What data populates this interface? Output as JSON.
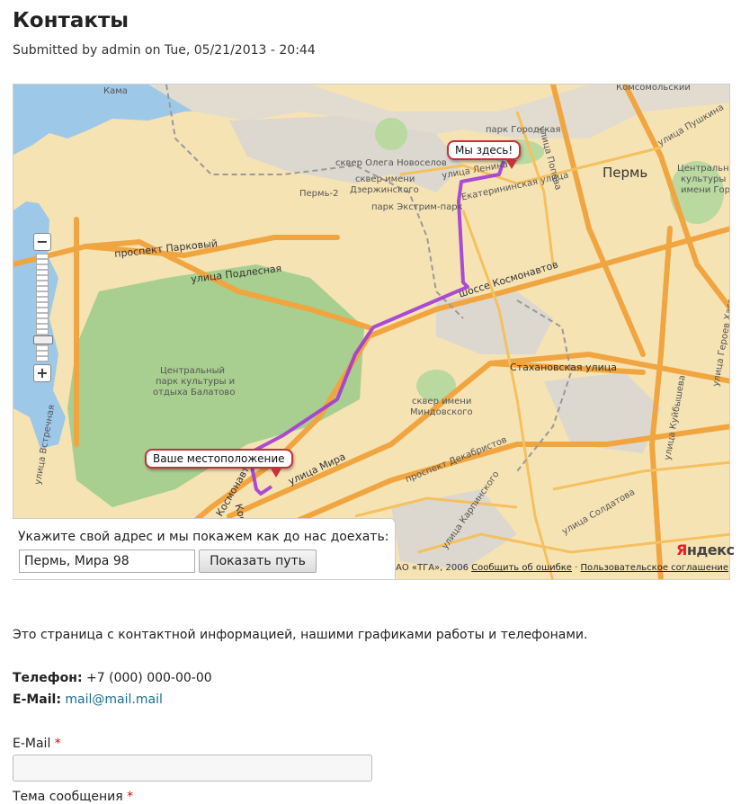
{
  "page": {
    "title": "Контакты",
    "submitted": "Submitted by admin on Tue, 05/21/2013 - 20:44"
  },
  "map": {
    "labels": {
      "kama": "Кама",
      "perm": "Пермь",
      "perm2": "Пермь-2",
      "prospekt_parkovy": "проспект Парковый",
      "podlesnaya": "улица Подлесная",
      "park_name_1": "Центральный",
      "park_name_2": "парк культуры и",
      "park_name_3": "отдыха Балатово",
      "lenina": "улица Ленина",
      "ekaterininskaya": "Екатерининская улица",
      "popova": "улица Попова",
      "pushkina": "улица Пушкина",
      "kosmonavtov": "шоссе Космонавтов",
      "kosmonavtov_2": "шоссе Космонавтов",
      "stakhanovskaya": "Стахановская улица",
      "mira": "улица Мира",
      "dekabristov": "проспект Декабристов",
      "karpinskogo": "улица Карпинского",
      "soldatova": "улица Солдатова",
      "kuybysheva": "улица Куйбышева",
      "geroev_khasana": "улица Героев Хасана",
      "vstrechnaya": "улица Встречная",
      "skver_novoselov_1": "сквер Олега Новоселов",
      "skver_novoselov_2": "сквер имени",
      "skver_novoselov_3": "Дзержинского",
      "park_ekstrim": "парк Экстрим-парк",
      "park_gorodskaya": "парк Городская",
      "skver_mindovskogo_1": "сквер имени",
      "skver_mindovskogo_2": "Миндовского",
      "park_tsentralny_1": "Центральный",
      "park_tsentralny_2": "культуры и",
      "park_tsentralny_3": "имени Горь",
      "komsomolsky": "Комсомольский",
      "kosmonavtov_3": "Космонавтов"
    },
    "zoom": {
      "minus": "−",
      "plus": "+",
      "level": 0.82
    },
    "bubbles": {
      "destination": "Мы здесь!",
      "origin": "Ваше местоположение"
    },
    "route_color": "#a23ad6",
    "route_form": {
      "prompt": "Укажите свой адрес и мы покажем как до нас доехать:",
      "address_value": "Пермь, Мира 98",
      "button": "Показать путь"
    },
    "copyright": {
      "prefix": "АО «ТГА», 2006",
      "report_error": "Сообщить об ошибке",
      "separator": "·",
      "user_agreement": "Пользовательское соглашение"
    },
    "logo": {
      "first": "Я",
      "rest": "ндекс"
    }
  },
  "content": {
    "intro": "Это страница с контактной информацией, нашими графиками работы и телефонами.",
    "phone_label": "Телефон:",
    "phone_value": "+7 (000) 000-00-00",
    "email_label": "E-Mail:",
    "email_value": "mail@mail.mail"
  },
  "form": {
    "email_label": "E-Mail",
    "required_marker": "*",
    "next_label": "Тема сообщения",
    "next_required": "*"
  }
}
